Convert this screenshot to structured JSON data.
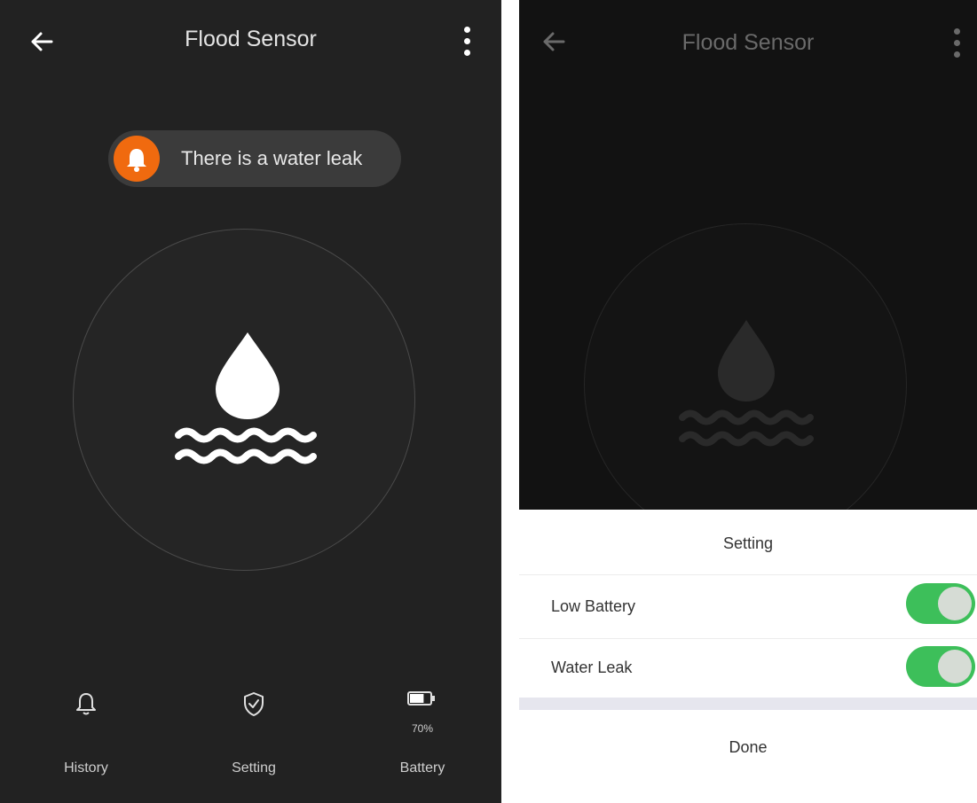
{
  "left": {
    "title": "Flood Sensor",
    "alert": {
      "text": "There is a water leak",
      "color": "#f06a0f"
    },
    "bottom_nav": [
      {
        "label": "History",
        "icon": "bell-icon"
      },
      {
        "label": "Setting",
        "icon": "shield-check-icon"
      },
      {
        "label": "Battery",
        "icon": "battery-icon",
        "value": "70%",
        "level": 0.7
      }
    ]
  },
  "right": {
    "title": "Flood Sensor",
    "sheet": {
      "title": "Setting",
      "rows": [
        {
          "label": "Low Battery",
          "enabled": true
        },
        {
          "label": "Water Leak",
          "enabled": true
        }
      ],
      "done_label": "Done"
    }
  },
  "colors": {
    "toggle_on": "#3dbf5a",
    "alert": "#f06a0f",
    "background": "#222222"
  }
}
